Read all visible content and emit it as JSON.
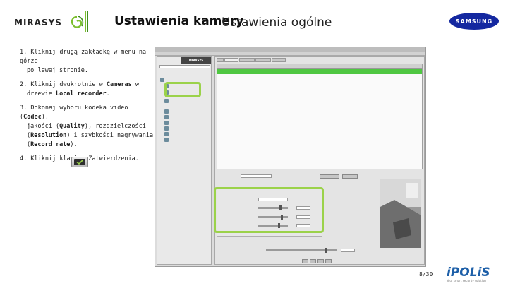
{
  "header": {
    "logo_text": "MIRASYS",
    "title": "Ustawienia kamery",
    "subtitle": "Ustawienia ogólne",
    "brand_logo_text": "SAMSUNG"
  },
  "instructions": {
    "step1": {
      "num": "1.",
      "line1": "Kliknij drugą zakładkę w menu na górze",
      "line2": "po lewej stronie."
    },
    "step2": {
      "num": "2.",
      "pre": "Kliknij dwukrotnie w",
      "bold1": "Cameras",
      "mid": "w",
      "line2_pre": "drzewie",
      "bold2": "Local recorder",
      "end": "."
    },
    "step3": {
      "num": "3.",
      "pre": "Dokonaj wyboru  kodeka video (",
      "codec": "Codec",
      "close": "),",
      "l2_pre": "jakości (",
      "quality": "Quality",
      "l2_post": "), rozdzielczości",
      "l3_open": "(",
      "resolution": "Resolution",
      "l3_post": ") i szybkości nagrywania",
      "l4_open": "(",
      "record_rate": "Record rate",
      "l4_post": ")."
    },
    "step4": {
      "num": "4.",
      "text": "Kliknij klawisz Zatwierdzenia."
    }
  },
  "app": {
    "brand": "MIRASYS"
  },
  "footer": {
    "page": "8/30",
    "brand": "iPOLiS",
    "tagline": "Your smart security solution"
  },
  "colors": {
    "highlight": "#9bd24a",
    "grid_row": "#4fc742",
    "samsung_blue": "#1428a0",
    "ipolis_blue": "#1d5fa8"
  }
}
